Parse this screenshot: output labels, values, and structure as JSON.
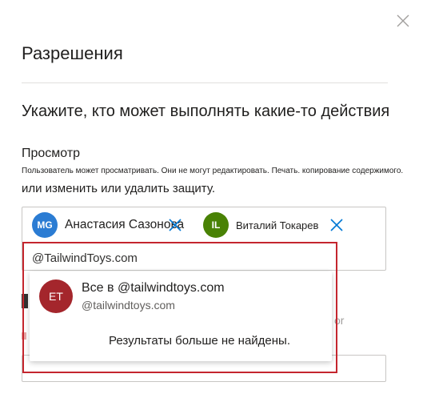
{
  "dialog": {
    "title": "Разрешения",
    "heading": "Укажите, кто может выполнять какие-то действия"
  },
  "permission": {
    "label": "Просмотр",
    "description": "Пользователь может просматривать. Они не могут редактировать. Печать. копирование содержимого.",
    "description2": "или изменить или удалить защиту."
  },
  "people": [
    {
      "initials": "MG",
      "name": "Анастасия Сазонова",
      "color": "#2b7cd3"
    },
    {
      "initials": "IL",
      "name": "Виталий Токарев",
      "color": "#498205"
    }
  ],
  "search": {
    "value": "@TailwindToys.com"
  },
  "suggestion": {
    "initials": "ET",
    "title": "Все в @tailwindtoys.com",
    "subtitle": "@tailwindtoys.com",
    "color": "#a4262c"
  },
  "no_more_results": "Результаты больше не найдены.",
  "partial_text": "or",
  "colors": {
    "highlight": "#c4262e",
    "remove_icon": "#0078d4"
  },
  "icons": {
    "close": "close-icon",
    "remove": "remove-icon"
  }
}
